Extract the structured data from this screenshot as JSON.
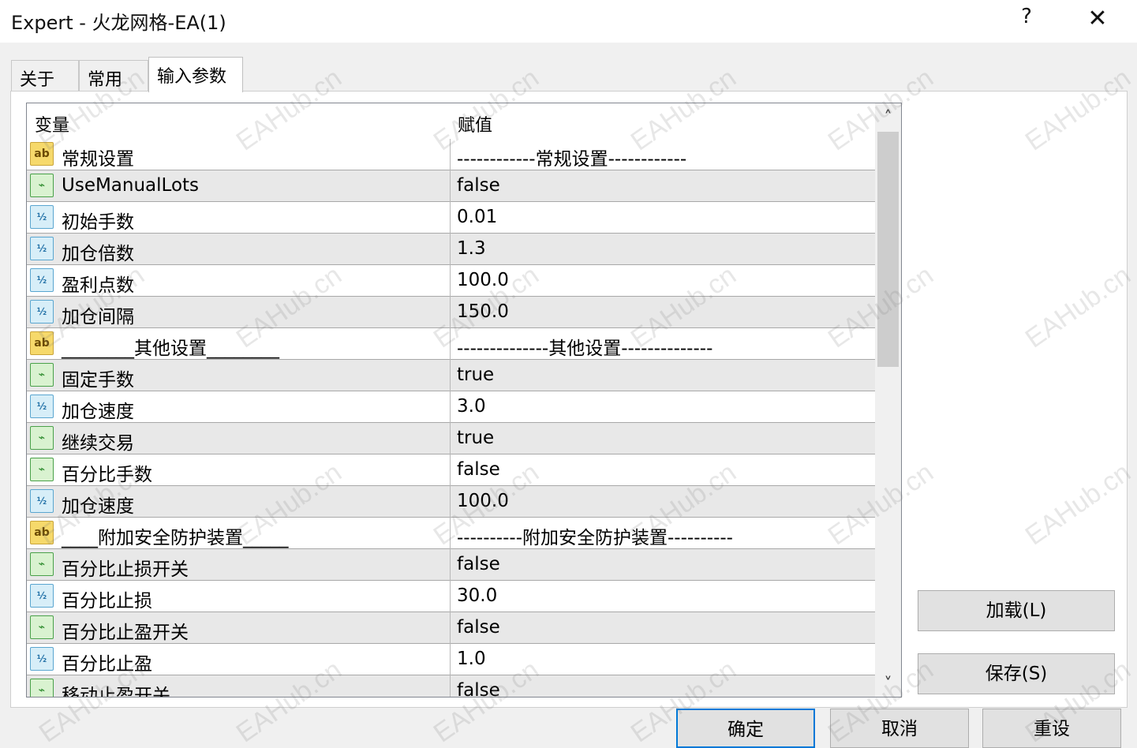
{
  "window": {
    "title": "Expert - 火龙网格-EA(1)",
    "help_label": "?",
    "close_label": "✕"
  },
  "tabs": [
    {
      "label": "关于"
    },
    {
      "label": "常用"
    },
    {
      "label": "输入参数"
    }
  ],
  "grid": {
    "header": {
      "variable": "变量",
      "value": "赋值"
    },
    "scroll_up": "˄",
    "scroll_down": "˅",
    "rows": [
      {
        "icon": "ab",
        "name": "常规设置",
        "value": "------------常规设置------------"
      },
      {
        "icon": "bool",
        "name": "UseManualLots",
        "value": "false"
      },
      {
        "icon": "num",
        "name": "初始手数",
        "value": "0.01"
      },
      {
        "icon": "num",
        "name": "加仓倍数",
        "value": "1.3"
      },
      {
        "icon": "num",
        "name": "盈利点数",
        "value": "100.0"
      },
      {
        "icon": "num",
        "name": "加仓间隔",
        "value": "150.0"
      },
      {
        "icon": "ab",
        "name": "________其他设置________",
        "value": "--------------其他设置--------------"
      },
      {
        "icon": "bool",
        "name": "固定手数",
        "value": "true"
      },
      {
        "icon": "num",
        "name": "加仓速度",
        "value": "3.0"
      },
      {
        "icon": "bool",
        "name": "继续交易",
        "value": "true"
      },
      {
        "icon": "bool",
        "name": "百分比手数",
        "value": "false"
      },
      {
        "icon": "num",
        "name": "加仓速度",
        "value": "100.0"
      },
      {
        "icon": "ab",
        "name": "____附加安全防护装置_____",
        "value": "----------附加安全防护装置----------"
      },
      {
        "icon": "bool",
        "name": "百分比止损开关",
        "value": "false"
      },
      {
        "icon": "num",
        "name": "百分比止损",
        "value": "30.0"
      },
      {
        "icon": "bool",
        "name": "百分比止盈开关",
        "value": "false"
      },
      {
        "icon": "num",
        "name": "百分比止盈",
        "value": "1.0"
      },
      {
        "icon": "bool",
        "name": "移动止盈开关",
        "value": "false"
      }
    ]
  },
  "icons": {
    "ab": "ab",
    "bool": "⌁",
    "num": "½"
  },
  "buttons": {
    "load": "加载(L)",
    "save": "保存(S)",
    "ok": "确定",
    "cancel": "取消",
    "reset": "重设"
  },
  "watermark": "EAHub.cn",
  "colors": {
    "accent": "#0078d7",
    "alt_row": "#e8e8e8"
  }
}
